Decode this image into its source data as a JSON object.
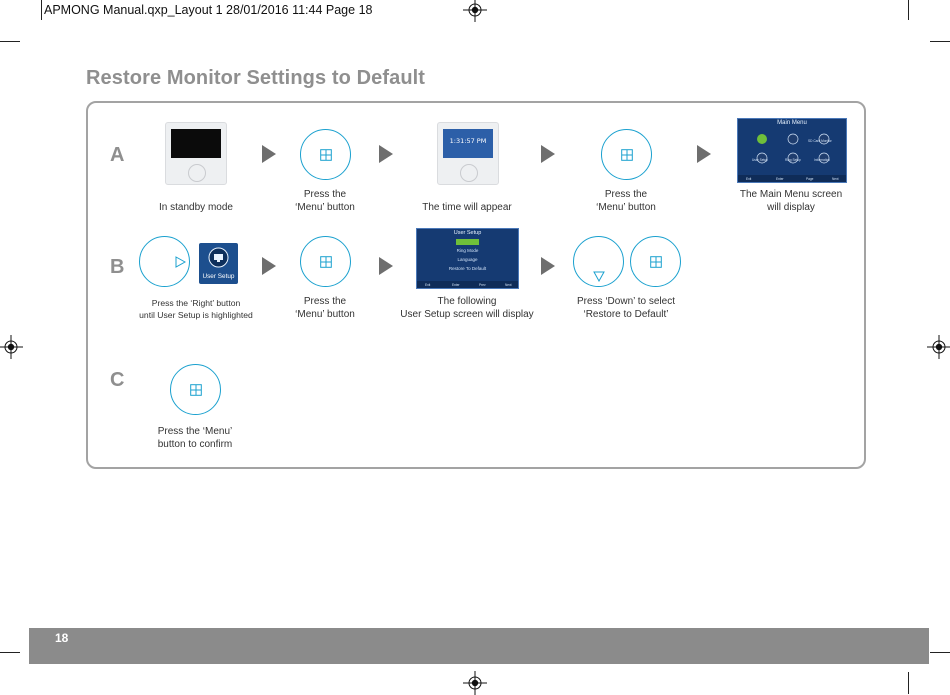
{
  "print_slug": "APMONG Manual.qxp_Layout 1  28/01/2016  11:44  Page 18",
  "title": "Restore Monitor Settings to Default",
  "rows": {
    "a": {
      "letter": "A",
      "captions": {
        "standby": "In standby mode",
        "menu_press_1": [
          "Press the",
          "‘Menu’ button"
        ],
        "time_appear": "The time will appear",
        "menu_press_2": [
          "Press the",
          "‘Menu’ button"
        ],
        "main_menu": [
          "The Main Menu screen",
          "will display"
        ]
      },
      "screen_time": "1:31:57 PM"
    },
    "b": {
      "letter": "B",
      "captions": {
        "press_right": [
          "Press the ‘Right’ button",
          "until User Setup is highlighted"
        ],
        "menu_press": [
          "Press the",
          "‘Menu’ button"
        ],
        "user_setup": [
          "The following",
          "User Setup screen will display"
        ],
        "press_down": [
          "Press ‘Down’  to select",
          "‘Restore to Default’"
        ]
      },
      "tile_label": "User Setup"
    },
    "c": {
      "letter": "C",
      "captions": {
        "confirm": [
          "Press the ‘Menu’",
          "button to confirm"
        ]
      }
    }
  },
  "main_menu_screen": {
    "title": "Main Menu",
    "items": [
      "",
      "",
      "SD Card Monitor",
      "User Setup",
      "Ring Setup",
      "Information"
    ],
    "footer": [
      "Exit",
      "Enter",
      "Page",
      "Next"
    ]
  },
  "user_setup_screen": {
    "title": "User Setup",
    "items": [
      "",
      "Ring Mode",
      "Language",
      "Restore To Default"
    ],
    "footer": [
      "Exit",
      "Enter",
      "Prev",
      "Next"
    ]
  },
  "page_number": "18",
  "colors": {
    "accent_circle": "#1ba1cf",
    "title_grey": "#8f8f8f",
    "footer_bar": "#8b8b8b",
    "arrow": "#6e6e6e",
    "screen_blue": "#153a72",
    "highlight_green": "#6fbf3a"
  },
  "icons": {
    "menu": "menu-grid-icon",
    "right": "triangle-right-icon",
    "down": "triangle-down-icon",
    "registration": "registration-mark-icon"
  }
}
